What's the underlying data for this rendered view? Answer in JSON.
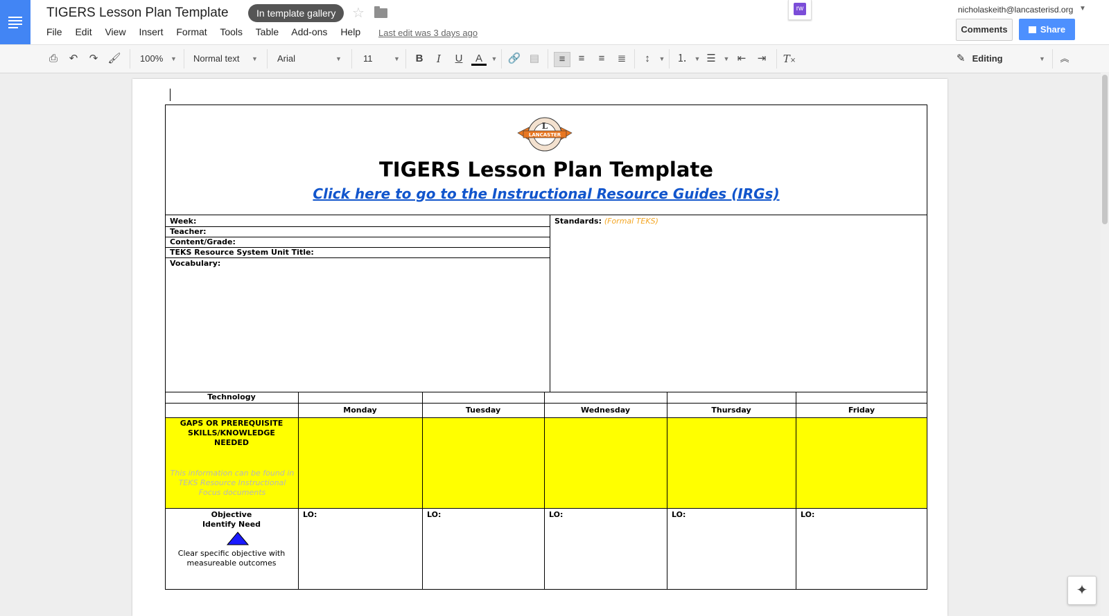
{
  "header": {
    "doc_title": "TIGERS Lesson Plan Template",
    "gallery_badge": "In template gallery",
    "menu": [
      "File",
      "Edit",
      "View",
      "Insert",
      "Format",
      "Tools",
      "Table",
      "Add-ons",
      "Help"
    ],
    "last_edit": "Last edit was 3 days ago",
    "extension_label": "rw",
    "user_email": "nicholaskeith@lancasterisd.org",
    "comments_label": "Comments",
    "share_label": "Share",
    "accent_color": "#4285f4",
    "share_color": "#4d90fe"
  },
  "toolbar": {
    "zoom": "100%",
    "style": "Normal text",
    "font": "Arial",
    "font_size": "11",
    "bold": "B",
    "italic": "I",
    "underline": "U",
    "text_color": "A",
    "mode": "Editing"
  },
  "document": {
    "seal_text": "LANCASTER",
    "heading": "TIGERS Lesson Plan Template",
    "link_text": "Click here to go to the Instructional Resource Guides (IRGs)",
    "link_color": "#1155cc",
    "fields": [
      "Week:",
      "Teacher:",
      "Content/Grade:",
      "TEKS Resource System Unit Title:",
      "Vocabulary:"
    ],
    "standards_label": "Standards:",
    "standards_hint": "(Formal TEKS)",
    "standards_hint_color": "#f4a623",
    "technology_label": "Technology",
    "days": [
      "Monday",
      "Tuesday",
      "Wednesday",
      "Thursday",
      "Friday"
    ],
    "gaps_heading": "GAPS OR PREREQUISITE SKILLS/KNOWLEDGE NEEDED",
    "gaps_note": "This information can be found in TEKS Resource Instructional Focus documents",
    "gaps_color": "#ffff00",
    "objective_title": "Objective",
    "objective_subtitle": "Identify Need",
    "objective_desc": "Clear specific objective with measureable outcomes",
    "lo_label": "LO:",
    "triangle_color": "#1a1aff"
  }
}
